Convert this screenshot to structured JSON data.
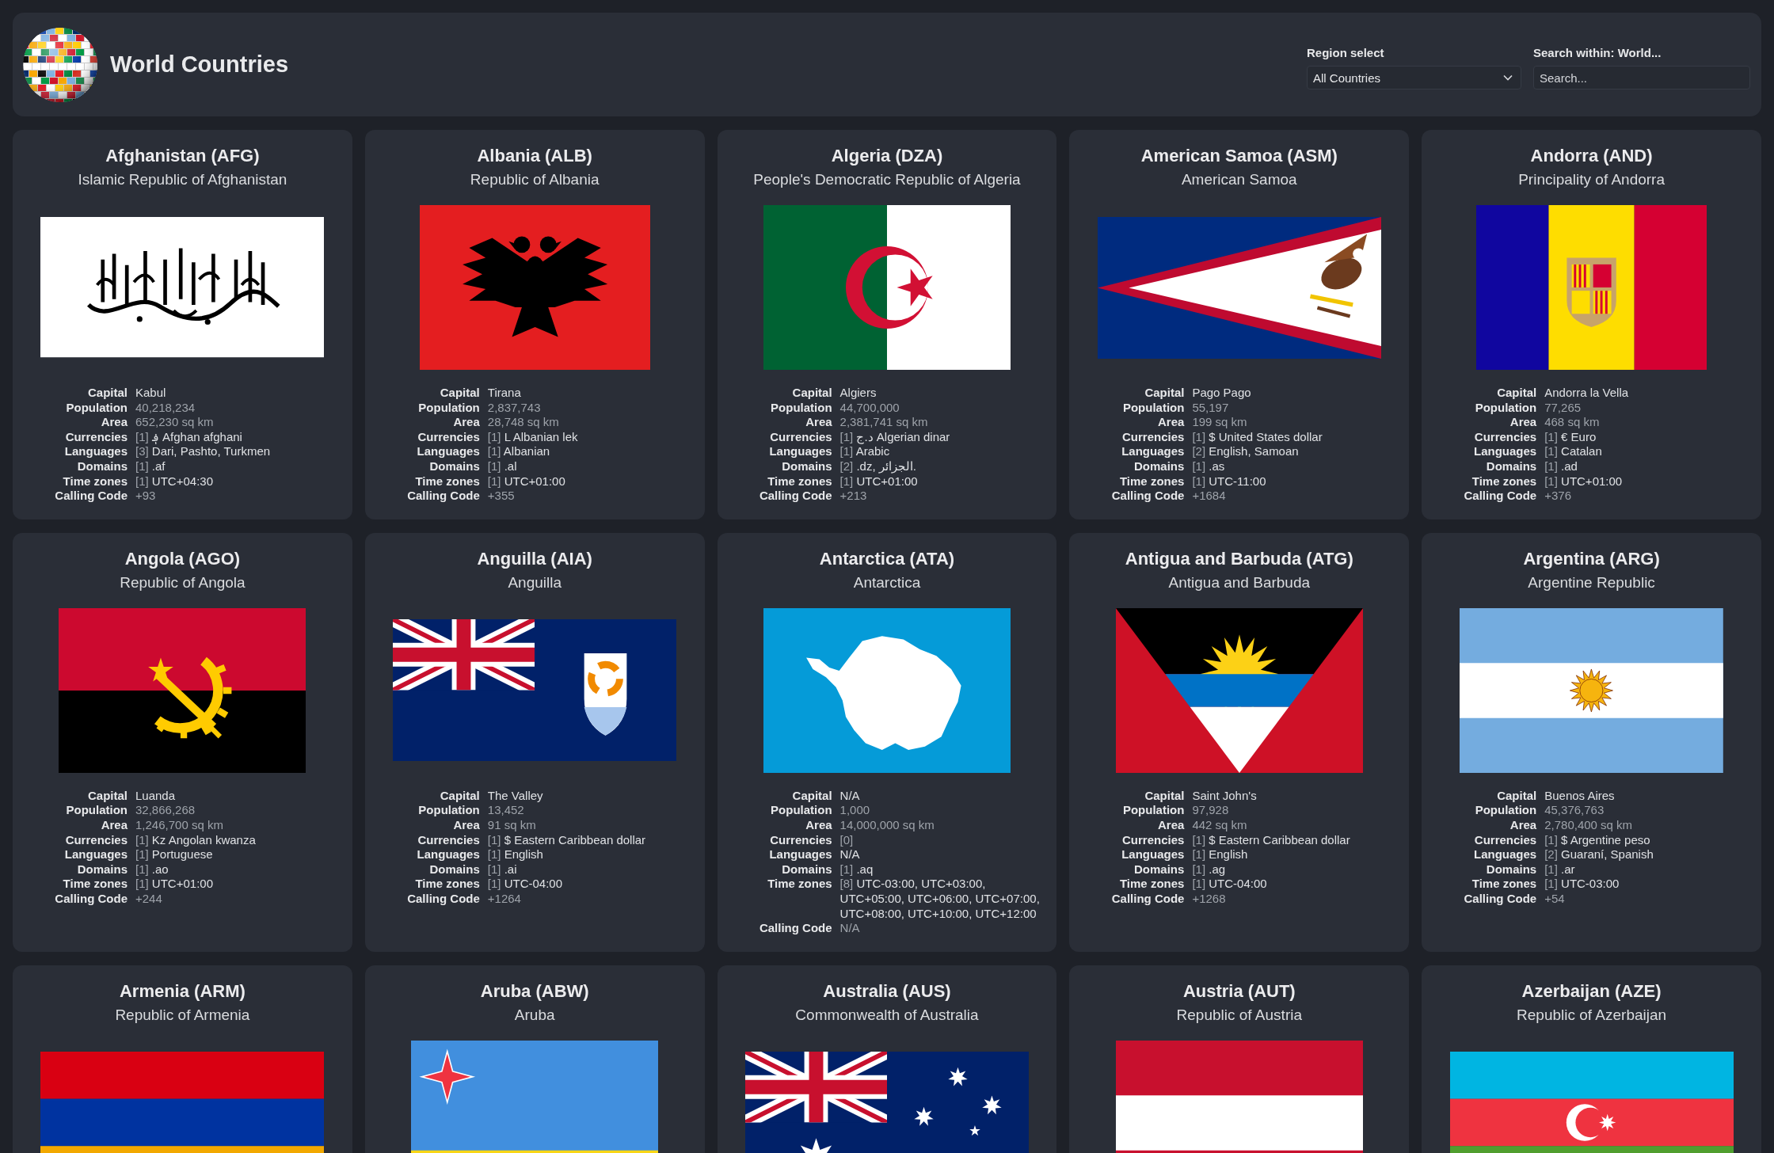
{
  "header": {
    "title": "World Countries",
    "region_select": {
      "label": "Region select",
      "value": "All Countries"
    },
    "search": {
      "label": "Search within: World...",
      "placeholder": "Search..."
    }
  },
  "countries": [
    {
      "name": "Afghanistan (AFG)",
      "official": "Islamic Republic of Afghanistan",
      "details": [
        {
          "label": "Capital",
          "kind": "text",
          "value": "Kabul"
        },
        {
          "label": "Population",
          "kind": "stat",
          "value": "40,218,234"
        },
        {
          "label": "Area",
          "kind": "stat",
          "value": "652,230 sq km"
        },
        {
          "label": "Currencies",
          "kind": "text",
          "count": "[1]",
          "value": "؋ Afghan afghani"
        },
        {
          "label": "Languages",
          "kind": "text",
          "count": "[3]",
          "value": "Dari, Pashto, Turkmen"
        },
        {
          "label": "Domains",
          "kind": "text",
          "count": "[1]",
          "value": ".af"
        },
        {
          "label": "Time zones",
          "kind": "text",
          "count": "[1]",
          "value": "UTC+04:30"
        },
        {
          "label": "Calling Code",
          "kind": "stat",
          "value": "+93"
        }
      ]
    },
    {
      "name": "Albania (ALB)",
      "official": "Republic of Albania",
      "details": [
        {
          "label": "Capital",
          "kind": "text",
          "value": "Tirana"
        },
        {
          "label": "Population",
          "kind": "stat",
          "value": "2,837,743"
        },
        {
          "label": "Area",
          "kind": "stat",
          "value": "28,748 sq km"
        },
        {
          "label": "Currencies",
          "kind": "text",
          "count": "[1]",
          "value": "L Albanian lek"
        },
        {
          "label": "Languages",
          "kind": "text",
          "count": "[1]",
          "value": "Albanian"
        },
        {
          "label": "Domains",
          "kind": "text",
          "count": "[1]",
          "value": ".al"
        },
        {
          "label": "Time zones",
          "kind": "text",
          "count": "[1]",
          "value": "UTC+01:00"
        },
        {
          "label": "Calling Code",
          "kind": "stat",
          "value": "+355"
        }
      ]
    },
    {
      "name": "Algeria (DZA)",
      "official": "People's Democratic Republic of Algeria",
      "details": [
        {
          "label": "Capital",
          "kind": "text",
          "value": "Algiers"
        },
        {
          "label": "Population",
          "kind": "stat",
          "value": "44,700,000"
        },
        {
          "label": "Area",
          "kind": "stat",
          "value": "2,381,741 sq km"
        },
        {
          "label": "Currencies",
          "kind": "text",
          "count": "[1]",
          "value": "د.ج Algerian dinar"
        },
        {
          "label": "Languages",
          "kind": "text",
          "count": "[1]",
          "value": "Arabic"
        },
        {
          "label": "Domains",
          "kind": "text",
          "count": "[2]",
          "value": ".dz, الجزائر."
        },
        {
          "label": "Time zones",
          "kind": "text",
          "count": "[1]",
          "value": "UTC+01:00"
        },
        {
          "label": "Calling Code",
          "kind": "stat",
          "value": "+213"
        }
      ]
    },
    {
      "name": "American Samoa (ASM)",
      "official": "American Samoa",
      "details": [
        {
          "label": "Capital",
          "kind": "text",
          "value": "Pago Pago"
        },
        {
          "label": "Population",
          "kind": "stat",
          "value": "55,197"
        },
        {
          "label": "Area",
          "kind": "stat",
          "value": "199 sq km"
        },
        {
          "label": "Currencies",
          "kind": "text",
          "count": "[1]",
          "value": "$ United States dollar"
        },
        {
          "label": "Languages",
          "kind": "text",
          "count": "[2]",
          "value": "English, Samoan"
        },
        {
          "label": "Domains",
          "kind": "text",
          "count": "[1]",
          "value": ".as"
        },
        {
          "label": "Time zones",
          "kind": "text",
          "count": "[1]",
          "value": "UTC-11:00"
        },
        {
          "label": "Calling Code",
          "kind": "stat",
          "value": "+1684"
        }
      ]
    },
    {
      "name": "Andorra (AND)",
      "official": "Principality of Andorra",
      "details": [
        {
          "label": "Capital",
          "kind": "text",
          "value": "Andorra la Vella"
        },
        {
          "label": "Population",
          "kind": "stat",
          "value": "77,265"
        },
        {
          "label": "Area",
          "kind": "stat",
          "value": "468 sq km"
        },
        {
          "label": "Currencies",
          "kind": "text",
          "count": "[1]",
          "value": "€ Euro"
        },
        {
          "label": "Languages",
          "kind": "text",
          "count": "[1]",
          "value": "Catalan"
        },
        {
          "label": "Domains",
          "kind": "text",
          "count": "[1]",
          "value": ".ad"
        },
        {
          "label": "Time zones",
          "kind": "text",
          "count": "[1]",
          "value": "UTC+01:00"
        },
        {
          "label": "Calling Code",
          "kind": "stat",
          "value": "+376"
        }
      ]
    },
    {
      "name": "Angola (AGO)",
      "official": "Republic of Angola",
      "details": [
        {
          "label": "Capital",
          "kind": "text",
          "value": "Luanda"
        },
        {
          "label": "Population",
          "kind": "stat",
          "value": "32,866,268"
        },
        {
          "label": "Area",
          "kind": "stat",
          "value": "1,246,700 sq km"
        },
        {
          "label": "Currencies",
          "kind": "text",
          "count": "[1]",
          "value": "Kz Angolan kwanza"
        },
        {
          "label": "Languages",
          "kind": "text",
          "count": "[1]",
          "value": "Portuguese"
        },
        {
          "label": "Domains",
          "kind": "text",
          "count": "[1]",
          "value": ".ao"
        },
        {
          "label": "Time zones",
          "kind": "text",
          "count": "[1]",
          "value": "UTC+01:00"
        },
        {
          "label": "Calling Code",
          "kind": "stat",
          "value": "+244"
        }
      ]
    },
    {
      "name": "Anguilla (AIA)",
      "official": "Anguilla",
      "details": [
        {
          "label": "Capital",
          "kind": "text",
          "value": "The Valley"
        },
        {
          "label": "Population",
          "kind": "stat",
          "value": "13,452"
        },
        {
          "label": "Area",
          "kind": "stat",
          "value": "91 sq km"
        },
        {
          "label": "Currencies",
          "kind": "text",
          "count": "[1]",
          "value": "$ Eastern Caribbean dollar"
        },
        {
          "label": "Languages",
          "kind": "text",
          "count": "[1]",
          "value": "English"
        },
        {
          "label": "Domains",
          "kind": "text",
          "count": "[1]",
          "value": ".ai"
        },
        {
          "label": "Time zones",
          "kind": "text",
          "count": "[1]",
          "value": "UTC-04:00"
        },
        {
          "label": "Calling Code",
          "kind": "stat",
          "value": "+1264"
        }
      ]
    },
    {
      "name": "Antarctica (ATA)",
      "official": "Antarctica",
      "details": [
        {
          "label": "Capital",
          "kind": "text",
          "value": "N/A"
        },
        {
          "label": "Population",
          "kind": "stat",
          "value": "1,000"
        },
        {
          "label": "Area",
          "kind": "stat",
          "value": "14,000,000 sq km"
        },
        {
          "label": "Currencies",
          "kind": "text",
          "count": "[0]"
        },
        {
          "label": "Languages",
          "kind": "text",
          "value": "N/A"
        },
        {
          "label": "Domains",
          "kind": "text",
          "count": "[1]",
          "value": ".aq"
        },
        {
          "label": "Time zones",
          "kind": "text",
          "count": "[8]",
          "value": "UTC-03:00, UTC+03:00, UTC+05:00, UTC+06:00, UTC+07:00, UTC+08:00, UTC+10:00, UTC+12:00"
        },
        {
          "label": "Calling Code",
          "kind": "stat",
          "value": "N/A"
        }
      ]
    },
    {
      "name": "Antigua and Barbuda (ATG)",
      "official": "Antigua and Barbuda",
      "details": [
        {
          "label": "Capital",
          "kind": "text",
          "value": "Saint John's"
        },
        {
          "label": "Population",
          "kind": "stat",
          "value": "97,928"
        },
        {
          "label": "Area",
          "kind": "stat",
          "value": "442 sq km"
        },
        {
          "label": "Currencies",
          "kind": "text",
          "count": "[1]",
          "value": "$ Eastern Caribbean dollar"
        },
        {
          "label": "Languages",
          "kind": "text",
          "count": "[1]",
          "value": "English"
        },
        {
          "label": "Domains",
          "kind": "text",
          "count": "[1]",
          "value": ".ag"
        },
        {
          "label": "Time zones",
          "kind": "text",
          "count": "[1]",
          "value": "UTC-04:00"
        },
        {
          "label": "Calling Code",
          "kind": "stat",
          "value": "+1268"
        }
      ]
    },
    {
      "name": "Argentina (ARG)",
      "official": "Argentine Republic",
      "details": [
        {
          "label": "Capital",
          "kind": "text",
          "value": "Buenos Aires"
        },
        {
          "label": "Population",
          "kind": "stat",
          "value": "45,376,763"
        },
        {
          "label": "Area",
          "kind": "stat",
          "value": "2,780,400 sq km"
        },
        {
          "label": "Currencies",
          "kind": "text",
          "count": "[1]",
          "value": "$ Argentine peso"
        },
        {
          "label": "Languages",
          "kind": "text",
          "count": "[2]",
          "value": "Guaraní, Spanish"
        },
        {
          "label": "Domains",
          "kind": "text",
          "count": "[1]",
          "value": ".ar"
        },
        {
          "label": "Time zones",
          "kind": "text",
          "count": "[1]",
          "value": "UTC-03:00"
        },
        {
          "label": "Calling Code",
          "kind": "stat",
          "value": "+54"
        }
      ]
    },
    {
      "name": "Armenia (ARM)",
      "official": "Republic of Armenia"
    },
    {
      "name": "Aruba (ABW)",
      "official": "Aruba"
    },
    {
      "name": "Australia (AUS)",
      "official": "Commonwealth of Australia"
    },
    {
      "name": "Austria (AUT)",
      "official": "Republic of Austria"
    },
    {
      "name": "Azerbaijan (AZE)",
      "official": "Republic of Azerbaijan"
    }
  ]
}
